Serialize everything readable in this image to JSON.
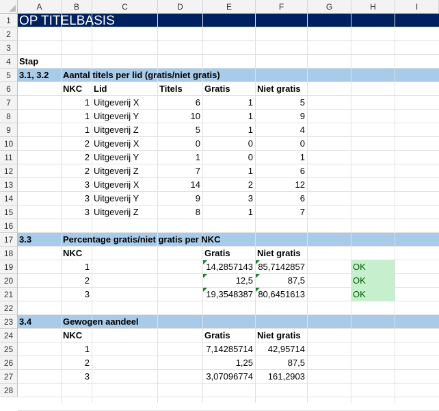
{
  "columns": [
    "A",
    "B",
    "C",
    "D",
    "E",
    "F",
    "G",
    "H",
    "I"
  ],
  "rows": [
    "1",
    "2",
    "3",
    "4",
    "5",
    "6",
    "7",
    "8",
    "9",
    "10",
    "11",
    "12",
    "13",
    "14",
    "15",
    "16",
    "17",
    "18",
    "19",
    "20",
    "21",
    "22",
    "23",
    "24",
    "25",
    "26",
    "27",
    "28"
  ],
  "title": "OP TITELBASIS",
  "stap_label": "Stap",
  "section1": {
    "step": "3.1, 3.2",
    "heading": "Aantal titels per lid (gratis/niet gratis)",
    "headers": [
      "NKC",
      "Lid",
      "Titels",
      "Gratis",
      "Niet gratis"
    ],
    "rows": [
      {
        "nkc": "1",
        "lid": "Uitgeverij X",
        "titels": "6",
        "gratis": "1",
        "niet": "5"
      },
      {
        "nkc": "1",
        "lid": "Uitgeverij Y",
        "titels": "10",
        "gratis": "1",
        "niet": "9"
      },
      {
        "nkc": "1",
        "lid": "Uitgeverij Z",
        "titels": "5",
        "gratis": "1",
        "niet": "4"
      },
      {
        "nkc": "2",
        "lid": "Uitgeverij X",
        "titels": "0",
        "gratis": "0",
        "niet": "0"
      },
      {
        "nkc": "2",
        "lid": "Uitgeverij Y",
        "titels": "1",
        "gratis": "0",
        "niet": "1"
      },
      {
        "nkc": "2",
        "lid": "Uitgeverij Z",
        "titels": "7",
        "gratis": "1",
        "niet": "6"
      },
      {
        "nkc": "3",
        "lid": "Uitgeverij X",
        "titels": "14",
        "gratis": "2",
        "niet": "12"
      },
      {
        "nkc": "3",
        "lid": "Uitgeverij Y",
        "titels": "9",
        "gratis": "3",
        "niet": "6"
      },
      {
        "nkc": "3",
        "lid": "Uitgeverij Z",
        "titels": "8",
        "gratis": "1",
        "niet": "7"
      }
    ]
  },
  "section2": {
    "step": "3.3",
    "heading": "Percentage gratis/niet gratis per NKC",
    "headers": [
      "NKC",
      "Gratis",
      "Niet gratis"
    ],
    "rows": [
      {
        "nkc": "1",
        "gratis": "14,2857143",
        "niet": "85,7142857",
        "check": "OK"
      },
      {
        "nkc": "2",
        "gratis": "12,5",
        "niet": "87,5",
        "check": "OK"
      },
      {
        "nkc": "3",
        "gratis": "19,3548387",
        "niet": "80,6451613",
        "check": "OK"
      }
    ]
  },
  "section3": {
    "step": "3.4",
    "heading": "Gewogen aandeel",
    "headers": [
      "NKC",
      "Gratis",
      "Niet gratis"
    ],
    "rows": [
      {
        "nkc": "1",
        "gratis": "7,14285714",
        "niet": "42,95714"
      },
      {
        "nkc": "2",
        "gratis": "1,25",
        "niet": "87,5"
      },
      {
        "nkc": "3",
        "gratis": "3,07096774",
        "niet": "161,2903"
      }
    ]
  },
  "colors": {
    "title_band": "#002060",
    "section_band": "#a9cbea",
    "ok_fill": "#c6efce",
    "ok_text": "#006100"
  }
}
